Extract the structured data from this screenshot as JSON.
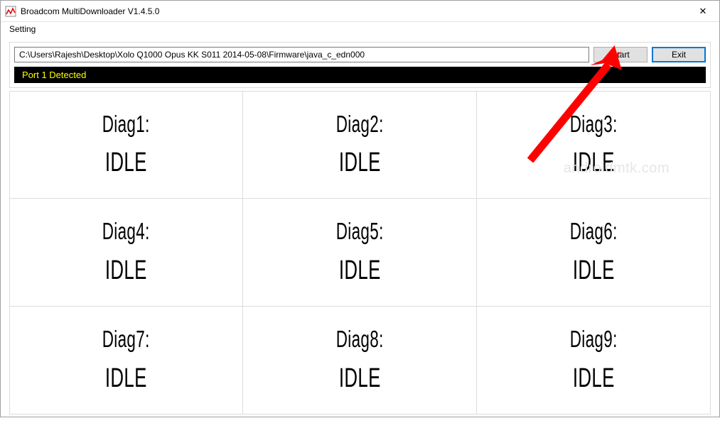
{
  "window": {
    "title": "Broadcom MultiDownloader V1.4.5.0",
    "close_symbol": "✕"
  },
  "menu": {
    "setting_label": "Setting"
  },
  "toolbar": {
    "path_value": "C:\\Users\\Rajesh\\Desktop\\Xolo Q1000 Opus KK S011 2014-05-08\\Firmware\\java_c_edn000",
    "start_label": "Start",
    "exit_label": "Exit"
  },
  "status": {
    "text": "Port 1 Detected"
  },
  "diag": {
    "cells": [
      {
        "label": "Diag1:",
        "status": "IDLE"
      },
      {
        "label": "Diag2:",
        "status": "IDLE"
      },
      {
        "label": "Diag3:",
        "status": "IDLE"
      },
      {
        "label": "Diag4:",
        "status": "IDLE"
      },
      {
        "label": "Diag5:",
        "status": "IDLE"
      },
      {
        "label": "Diag6:",
        "status": "IDLE"
      },
      {
        "label": "Diag7:",
        "status": "IDLE"
      },
      {
        "label": "Diag8:",
        "status": "IDLE"
      },
      {
        "label": "Diag9:",
        "status": "IDLE"
      }
    ]
  },
  "watermark": {
    "text": "androidmtk.com"
  },
  "colors": {
    "status_bg": "#000000",
    "status_fg": "#ffff00",
    "highlight_border": "#0078d7",
    "arrow": "#ff0000"
  }
}
